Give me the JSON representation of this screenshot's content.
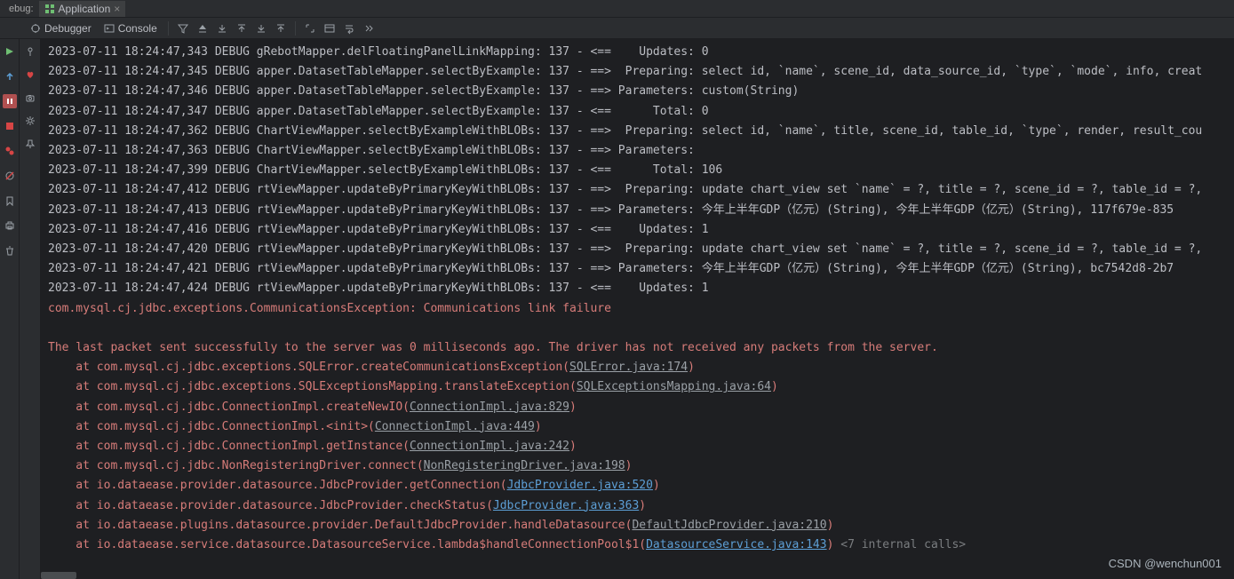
{
  "tabs": {
    "pane_label": "ebug:",
    "app": {
      "icon": "grid-icon",
      "label": "Application",
      "close": "×"
    }
  },
  "toolbar": {
    "debugger": "Debugger",
    "console": "Console",
    "icons": [
      "funnel",
      "arrow-up",
      "download",
      "upload",
      "download2",
      "upload-arrow",
      "expand",
      "layout",
      "wrap",
      "scroll"
    ]
  },
  "leftGutter": {
    "items": [
      "play-green",
      "arrow-up-blue",
      "pause-red-bg",
      "stop-red",
      "camera",
      "camera-red",
      "bookmark",
      "print",
      "trash"
    ]
  },
  "secondGutter": {
    "items": [
      "pin",
      "heart-red",
      "camera-grey",
      "gear",
      "tack"
    ]
  },
  "log": [
    {
      "t": "plain",
      "text": "2023-07-11 18:24:47,343 DEBUG gRebotMapper.delFloatingPanelLinkMapping: 137 - <==    Updates: 0"
    },
    {
      "t": "plain",
      "text": "2023-07-11 18:24:47,345 DEBUG apper.DatasetTableMapper.selectByExample: 137 - ==>  Preparing: select id, `name`, scene_id, data_source_id, `type`, `mode`, info, creat"
    },
    {
      "t": "plain",
      "text": "2023-07-11 18:24:47,346 DEBUG apper.DatasetTableMapper.selectByExample: 137 - ==> Parameters: custom(String)"
    },
    {
      "t": "plain",
      "text": "2023-07-11 18:24:47,347 DEBUG apper.DatasetTableMapper.selectByExample: 137 - <==      Total: 0"
    },
    {
      "t": "plain",
      "text": "2023-07-11 18:24:47,362 DEBUG ChartViewMapper.selectByExampleWithBLOBs: 137 - ==>  Preparing: select id, `name`, title, scene_id, table_id, `type`, render, result_cou"
    },
    {
      "t": "plain",
      "text": "2023-07-11 18:24:47,363 DEBUG ChartViewMapper.selectByExampleWithBLOBs: 137 - ==> Parameters: "
    },
    {
      "t": "plain",
      "text": "2023-07-11 18:24:47,399 DEBUG ChartViewMapper.selectByExampleWithBLOBs: 137 - <==      Total: 106"
    },
    {
      "t": "plain",
      "text": "2023-07-11 18:24:47,412 DEBUG rtViewMapper.updateByPrimaryKeyWithBLOBs: 137 - ==>  Preparing: update chart_view set `name` = ?, title = ?, scene_id = ?, table_id = ?,"
    },
    {
      "t": "plain",
      "text": "2023-07-11 18:24:47,413 DEBUG rtViewMapper.updateByPrimaryKeyWithBLOBs: 137 - ==> Parameters: 今年上半年GDP（亿元）(String), 今年上半年GDP（亿元）(String), 117f679e-835"
    },
    {
      "t": "plain",
      "text": "2023-07-11 18:24:47,416 DEBUG rtViewMapper.updateByPrimaryKeyWithBLOBs: 137 - <==    Updates: 1"
    },
    {
      "t": "plain",
      "text": "2023-07-11 18:24:47,420 DEBUG rtViewMapper.updateByPrimaryKeyWithBLOBs: 137 - ==>  Preparing: update chart_view set `name` = ?, title = ?, scene_id = ?, table_id = ?,"
    },
    {
      "t": "plain",
      "text": "2023-07-11 18:24:47,421 DEBUG rtViewMapper.updateByPrimaryKeyWithBLOBs: 137 - ==> Parameters: 今年上半年GDP（亿元）(String), 今年上半年GDP（亿元）(String), bc7542d8-2b7"
    },
    {
      "t": "plain",
      "text": "2023-07-11 18:24:47,424 DEBUG rtViewMapper.updateByPrimaryKeyWithBLOBs: 137 - <==    Updates: 1"
    },
    {
      "t": "err",
      "text": "com.mysql.cj.jdbc.exceptions.CommunicationsException: Communications link failure"
    },
    {
      "t": "err",
      "text": ""
    },
    {
      "t": "err",
      "text": "The last packet sent successfully to the server was 0 milliseconds ago. The driver has not received any packets from the server."
    },
    {
      "t": "stack",
      "pre": "    at com.mysql.cj.jdbc.exceptions.SQLError.createCommunicationsException(",
      "link": "",
      "ul": "SQLError.java:174",
      "post": ")"
    },
    {
      "t": "stack",
      "pre": "    at com.mysql.cj.jdbc.exceptions.SQLExceptionsMapping.translateException(",
      "link": "",
      "ul": "SQLExceptionsMapping.java:64",
      "post": ")"
    },
    {
      "t": "stack",
      "pre": "    at com.mysql.cj.jdbc.ConnectionImpl.createNewIO(",
      "link": "",
      "ul": "ConnectionImpl.java:829",
      "post": ")"
    },
    {
      "t": "stack",
      "pre": "    at com.mysql.cj.jdbc.ConnectionImpl.<init>(",
      "link": "",
      "ul": "ConnectionImpl.java:449",
      "post": ")"
    },
    {
      "t": "stack",
      "pre": "    at com.mysql.cj.jdbc.ConnectionImpl.getInstance(",
      "link": "",
      "ul": "ConnectionImpl.java:242",
      "post": ")"
    },
    {
      "t": "stack",
      "pre": "    at com.mysql.cj.jdbc.NonRegisteringDriver.connect(",
      "link": "",
      "ul": "NonRegisteringDriver.java:198",
      "post": ")"
    },
    {
      "t": "stack",
      "pre": "    at io.dataease.provider.datasource.JdbcProvider.getConnection(",
      "link": "JdbcProvider.java:520",
      "ul": "",
      "post": ")"
    },
    {
      "t": "stack",
      "pre": "    at io.dataease.provider.datasource.JdbcProvider.checkStatus(",
      "link": "JdbcProvider.java:363",
      "ul": "",
      "post": ")"
    },
    {
      "t": "stack",
      "pre": "    at io.dataease.plugins.datasource.provider.DefaultJdbcProvider.handleDatasource(",
      "link": "",
      "ul": "DefaultJdbcProvider.java:210",
      "post": ")"
    },
    {
      "t": "stack",
      "pre": "    at io.dataease.service.datasource.DatasourceService.lambda$handleConnectionPool$1(",
      "link": "DatasourceService.java:143",
      "ul": "",
      "post": ")",
      "tail": " <7 internal calls>",
      "fold": true
    }
  ],
  "watermark": "CSDN @wenchun001"
}
